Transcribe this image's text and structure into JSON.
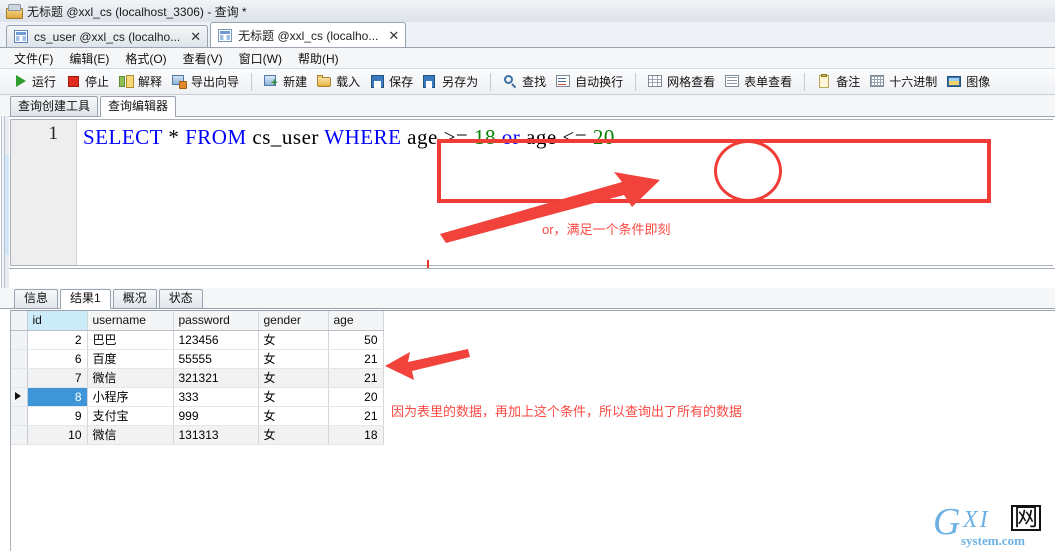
{
  "window": {
    "title": "无标题 @xxl_cs (localhost_3306) - 查询 *",
    "icon": "database-window-icon"
  },
  "doc_tabs": [
    {
      "label": "cs_user @xxl_cs (localho...",
      "close": "✕",
      "active": false,
      "icon": "table-icon"
    },
    {
      "label": "无标题 @xxl_cs (localho...",
      "close": "✕",
      "active": true,
      "icon": "query-icon"
    }
  ],
  "menu": [
    {
      "label": "文件(F)"
    },
    {
      "label": "编辑(E)"
    },
    {
      "label": "格式(O)"
    },
    {
      "label": "查看(V)"
    },
    {
      "label": "窗口(W)"
    },
    {
      "label": "帮助(H)"
    }
  ],
  "toolbar": [
    {
      "type": "button",
      "label": "运行",
      "icon": "run-icon"
    },
    {
      "type": "button",
      "label": "停止",
      "icon": "stop-icon"
    },
    {
      "type": "button",
      "label": "解释",
      "icon": "explain-icon"
    },
    {
      "type": "button",
      "label": "导出向导",
      "icon": "export-wizard-icon"
    },
    {
      "type": "sep"
    },
    {
      "type": "button",
      "label": "新建",
      "icon": "new-icon"
    },
    {
      "type": "button",
      "label": "载入",
      "icon": "load-icon"
    },
    {
      "type": "button",
      "label": "保存",
      "icon": "save-icon"
    },
    {
      "type": "button",
      "label": "另存为",
      "icon": "save-as-icon"
    },
    {
      "type": "sep"
    },
    {
      "type": "button",
      "label": "查找",
      "icon": "search-icon"
    },
    {
      "type": "button",
      "label": "自动换行",
      "icon": "word-wrap-icon"
    },
    {
      "type": "sep"
    },
    {
      "type": "button",
      "label": "网格查看",
      "icon": "grid-view-icon"
    },
    {
      "type": "button",
      "label": "表单查看",
      "icon": "form-view-icon"
    },
    {
      "type": "sep"
    },
    {
      "type": "button",
      "label": "备注",
      "icon": "memo-icon"
    },
    {
      "type": "button",
      "label": "十六进制",
      "icon": "hex-icon"
    },
    {
      "type": "button",
      "label": "图像",
      "icon": "image-icon"
    }
  ],
  "sub_tabs": [
    {
      "label": "查询创建工具",
      "active": false
    },
    {
      "label": "查询编辑器",
      "active": true
    }
  ],
  "editor": {
    "line_number": "1",
    "sql_tokens": [
      {
        "text": "SELECT",
        "kind": "kw"
      },
      {
        "text": " * ",
        "kind": "op"
      },
      {
        "text": "FROM",
        "kind": "kw"
      },
      {
        "text": " cs_user ",
        "kind": "id"
      },
      {
        "text": "WHERE",
        "kind": "kw"
      },
      {
        "text": " age ",
        "kind": "id"
      },
      {
        "text": ">=",
        "kind": "op"
      },
      {
        "text": " 18",
        "kind": "num"
      },
      {
        "text": " ",
        "kind": "id"
      },
      {
        "text": "or",
        "kind": "kw"
      },
      {
        "text": " age ",
        "kind": "id"
      },
      {
        "text": "<=",
        "kind": "op"
      },
      {
        "text": " 20",
        "kind": "num"
      }
    ],
    "sql_plain": "SELECT * FROM cs_user WHERE age >= 18 or age <= 20"
  },
  "annotations": {
    "note_or": "or，满足一个条件即刻",
    "note_result": "因为表里的数据，再加上这个条件，所以查询出了所有的数据",
    "highlight_color": "#f03c36",
    "text_color": "#fb4a43",
    "circled_token": "or"
  },
  "result_tabs": [
    {
      "label": "信息",
      "active": false
    },
    {
      "label": "结果1",
      "active": true
    },
    {
      "label": "概况",
      "active": false
    },
    {
      "label": "状态",
      "active": false
    }
  ],
  "grid": {
    "columns": [
      "id",
      "username",
      "password",
      "gender",
      "age"
    ],
    "selected_column": "id",
    "current_row_index": 3,
    "rows": [
      {
        "id": "2",
        "username": "巴巴",
        "password": "123456",
        "gender": "女",
        "age": "50"
      },
      {
        "id": "6",
        "username": "百度",
        "password": "55555",
        "gender": "女",
        "age": "21"
      },
      {
        "id": "7",
        "username": "微信",
        "password": "321321",
        "gender": "女",
        "age": "21"
      },
      {
        "id": "8",
        "username": "小程序",
        "password": "333",
        "gender": "女",
        "age": "20"
      },
      {
        "id": "9",
        "username": "支付宝",
        "password": "999",
        "gender": "女",
        "age": "21"
      },
      {
        "id": "10",
        "username": "微信",
        "password": "131313",
        "gender": "女",
        "age": "18"
      }
    ]
  },
  "watermark": {
    "letter": "G",
    "letters2": "XI",
    "box_char": "网",
    "subtitle": "system.com"
  }
}
